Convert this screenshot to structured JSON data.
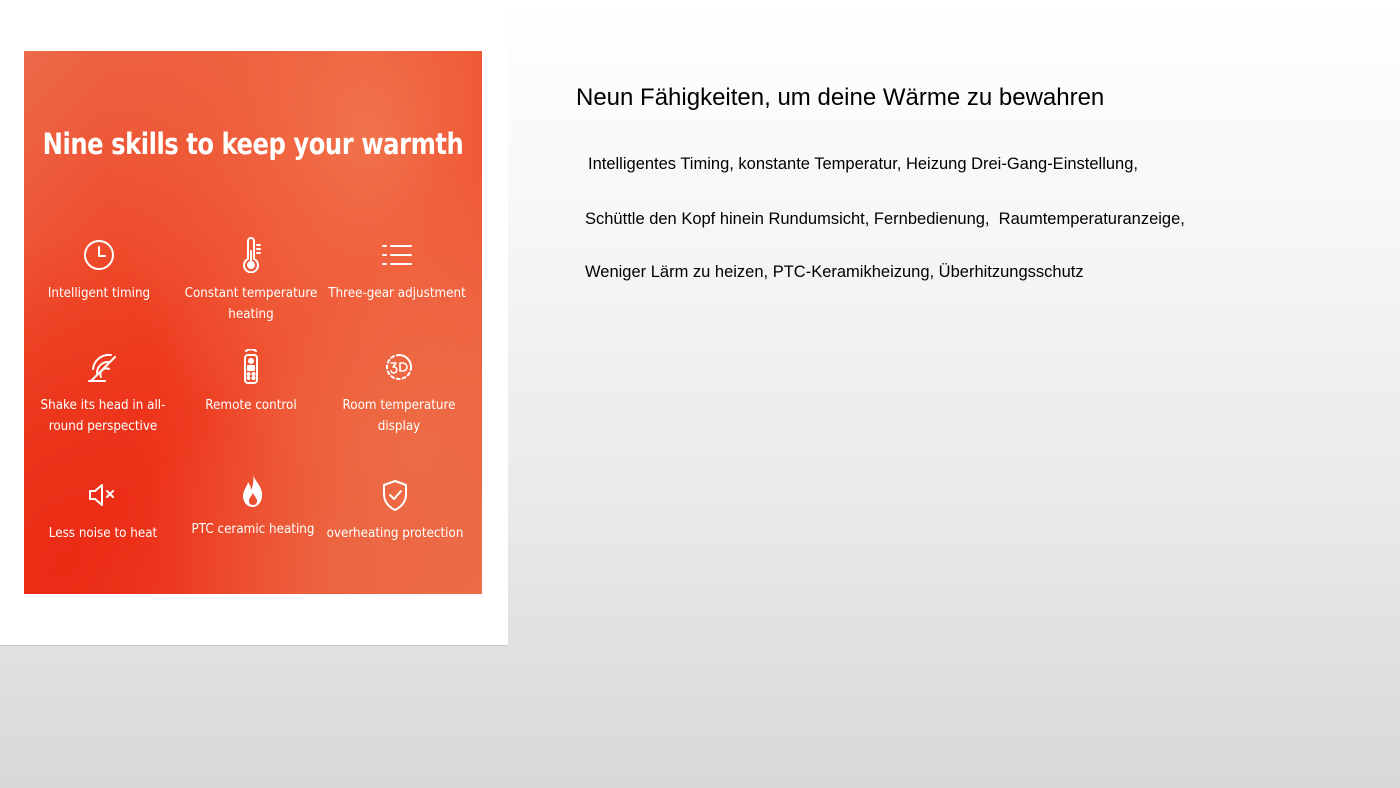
{
  "promo": {
    "title": "Nine skills to keep your warmth",
    "features": [
      {
        "label": "Intelligent timing",
        "icon": "clock-icon"
      },
      {
        "label": "Constant temperature heating",
        "icon": "thermometer-icon"
      },
      {
        "label": "Three-gear adjustment",
        "icon": "list-icon"
      },
      {
        "label": "Shake its head in all-round perspective",
        "icon": "oscillation-icon"
      },
      {
        "label": "Remote control",
        "icon": "remote-icon"
      },
      {
        "label": "Room temperature display",
        "icon": "3d-display-icon"
      },
      {
        "label": "Less noise to heat",
        "icon": "mute-speaker-icon"
      },
      {
        "label": "PTC ceramic heating",
        "icon": "flame-icon"
      },
      {
        "label": "overheating protection",
        "icon": "shield-check-icon"
      }
    ],
    "colors": {
      "primary": "#f0361c",
      "accent": "#ec6a4a"
    }
  },
  "description": {
    "heading": "Neun Fähigkeiten, um deine Wärme zu bewahren",
    "lines": [
      "Intelligentes Timing, konstante Temperatur, Heizung Drei-Gang-Einstellung,",
      "Schüttle den Kopf hinein Rundumsicht, Fernbedienung,  Raumtemperaturanzeige,",
      "Weniger Lärm zu heizen, PTC-Keramikheizung, Überhitzungsschutz"
    ]
  }
}
